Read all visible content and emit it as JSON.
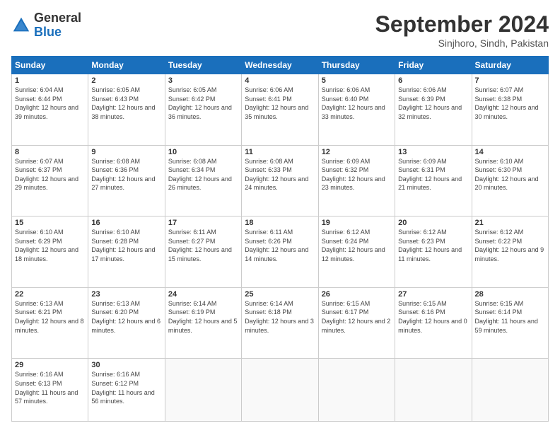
{
  "logo": {
    "general": "General",
    "blue": "Blue"
  },
  "title": "September 2024",
  "location": "Sinjhoro, Sindh, Pakistan",
  "weekdays": [
    "Sunday",
    "Monday",
    "Tuesday",
    "Wednesday",
    "Thursday",
    "Friday",
    "Saturday"
  ],
  "weeks": [
    [
      {
        "day": "1",
        "sunrise": "6:04 AM",
        "sunset": "6:44 PM",
        "daylight": "12 hours and 39 minutes."
      },
      {
        "day": "2",
        "sunrise": "6:05 AM",
        "sunset": "6:43 PM",
        "daylight": "12 hours and 38 minutes."
      },
      {
        "day": "3",
        "sunrise": "6:05 AM",
        "sunset": "6:42 PM",
        "daylight": "12 hours and 36 minutes."
      },
      {
        "day": "4",
        "sunrise": "6:06 AM",
        "sunset": "6:41 PM",
        "daylight": "12 hours and 35 minutes."
      },
      {
        "day": "5",
        "sunrise": "6:06 AM",
        "sunset": "6:40 PM",
        "daylight": "12 hours and 33 minutes."
      },
      {
        "day": "6",
        "sunrise": "6:06 AM",
        "sunset": "6:39 PM",
        "daylight": "12 hours and 32 minutes."
      },
      {
        "day": "7",
        "sunrise": "6:07 AM",
        "sunset": "6:38 PM",
        "daylight": "12 hours and 30 minutes."
      }
    ],
    [
      {
        "day": "8",
        "sunrise": "6:07 AM",
        "sunset": "6:37 PM",
        "daylight": "12 hours and 29 minutes."
      },
      {
        "day": "9",
        "sunrise": "6:08 AM",
        "sunset": "6:36 PM",
        "daylight": "12 hours and 27 minutes."
      },
      {
        "day": "10",
        "sunrise": "6:08 AM",
        "sunset": "6:34 PM",
        "daylight": "12 hours and 26 minutes."
      },
      {
        "day": "11",
        "sunrise": "6:08 AM",
        "sunset": "6:33 PM",
        "daylight": "12 hours and 24 minutes."
      },
      {
        "day": "12",
        "sunrise": "6:09 AM",
        "sunset": "6:32 PM",
        "daylight": "12 hours and 23 minutes."
      },
      {
        "day": "13",
        "sunrise": "6:09 AM",
        "sunset": "6:31 PM",
        "daylight": "12 hours and 21 minutes."
      },
      {
        "day": "14",
        "sunrise": "6:10 AM",
        "sunset": "6:30 PM",
        "daylight": "12 hours and 20 minutes."
      }
    ],
    [
      {
        "day": "15",
        "sunrise": "6:10 AM",
        "sunset": "6:29 PM",
        "daylight": "12 hours and 18 minutes."
      },
      {
        "day": "16",
        "sunrise": "6:10 AM",
        "sunset": "6:28 PM",
        "daylight": "12 hours and 17 minutes."
      },
      {
        "day": "17",
        "sunrise": "6:11 AM",
        "sunset": "6:27 PM",
        "daylight": "12 hours and 15 minutes."
      },
      {
        "day": "18",
        "sunrise": "6:11 AM",
        "sunset": "6:26 PM",
        "daylight": "12 hours and 14 minutes."
      },
      {
        "day": "19",
        "sunrise": "6:12 AM",
        "sunset": "6:24 PM",
        "daylight": "12 hours and 12 minutes."
      },
      {
        "day": "20",
        "sunrise": "6:12 AM",
        "sunset": "6:23 PM",
        "daylight": "12 hours and 11 minutes."
      },
      {
        "day": "21",
        "sunrise": "6:12 AM",
        "sunset": "6:22 PM",
        "daylight": "12 hours and 9 minutes."
      }
    ],
    [
      {
        "day": "22",
        "sunrise": "6:13 AM",
        "sunset": "6:21 PM",
        "daylight": "12 hours and 8 minutes."
      },
      {
        "day": "23",
        "sunrise": "6:13 AM",
        "sunset": "6:20 PM",
        "daylight": "12 hours and 6 minutes."
      },
      {
        "day": "24",
        "sunrise": "6:14 AM",
        "sunset": "6:19 PM",
        "daylight": "12 hours and 5 minutes."
      },
      {
        "day": "25",
        "sunrise": "6:14 AM",
        "sunset": "6:18 PM",
        "daylight": "12 hours and 3 minutes."
      },
      {
        "day": "26",
        "sunrise": "6:15 AM",
        "sunset": "6:17 PM",
        "daylight": "12 hours and 2 minutes."
      },
      {
        "day": "27",
        "sunrise": "6:15 AM",
        "sunset": "6:16 PM",
        "daylight": "12 hours and 0 minutes."
      },
      {
        "day": "28",
        "sunrise": "6:15 AM",
        "sunset": "6:14 PM",
        "daylight": "11 hours and 59 minutes."
      }
    ],
    [
      {
        "day": "29",
        "sunrise": "6:16 AM",
        "sunset": "6:13 PM",
        "daylight": "11 hours and 57 minutes."
      },
      {
        "day": "30",
        "sunrise": "6:16 AM",
        "sunset": "6:12 PM",
        "daylight": "11 hours and 56 minutes."
      },
      null,
      null,
      null,
      null,
      null
    ]
  ],
  "labels": {
    "sunrise": "Sunrise:",
    "sunset": "Sunset:",
    "daylight": "Daylight:"
  }
}
